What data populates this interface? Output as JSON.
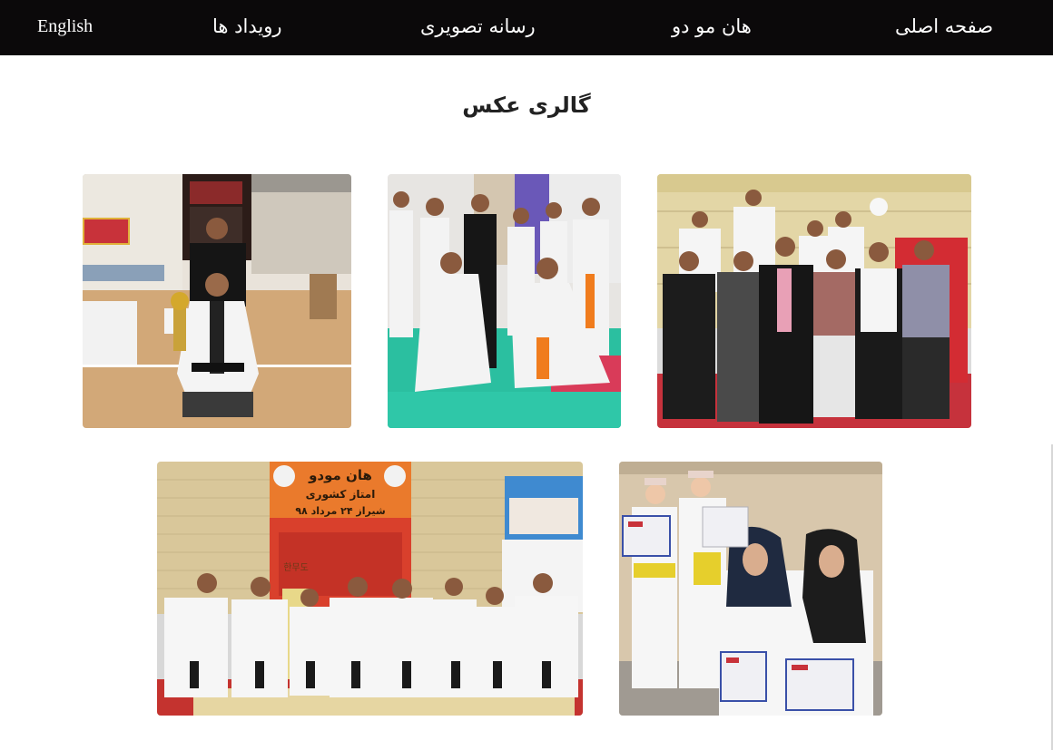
{
  "nav": {
    "english": "English",
    "events": "رویداد ها",
    "media": "رسانه تصویری",
    "hanmudo": "هان مو دو",
    "home": "صفحه اصلی"
  },
  "page": {
    "title": "گالری عکس"
  },
  "gallery": {
    "banner_hanmudo": "هان مودو",
    "banner_exam": "امتاز کشوری",
    "banner_location": "شیراز ۲۴ مرداد ۹۸",
    "banner_hangul": "한무도"
  },
  "colors": {
    "navbar_bg": "#0b090a",
    "nav_text": "#ffffff",
    "title_text": "#222222",
    "page_bg": "#ffffff"
  }
}
